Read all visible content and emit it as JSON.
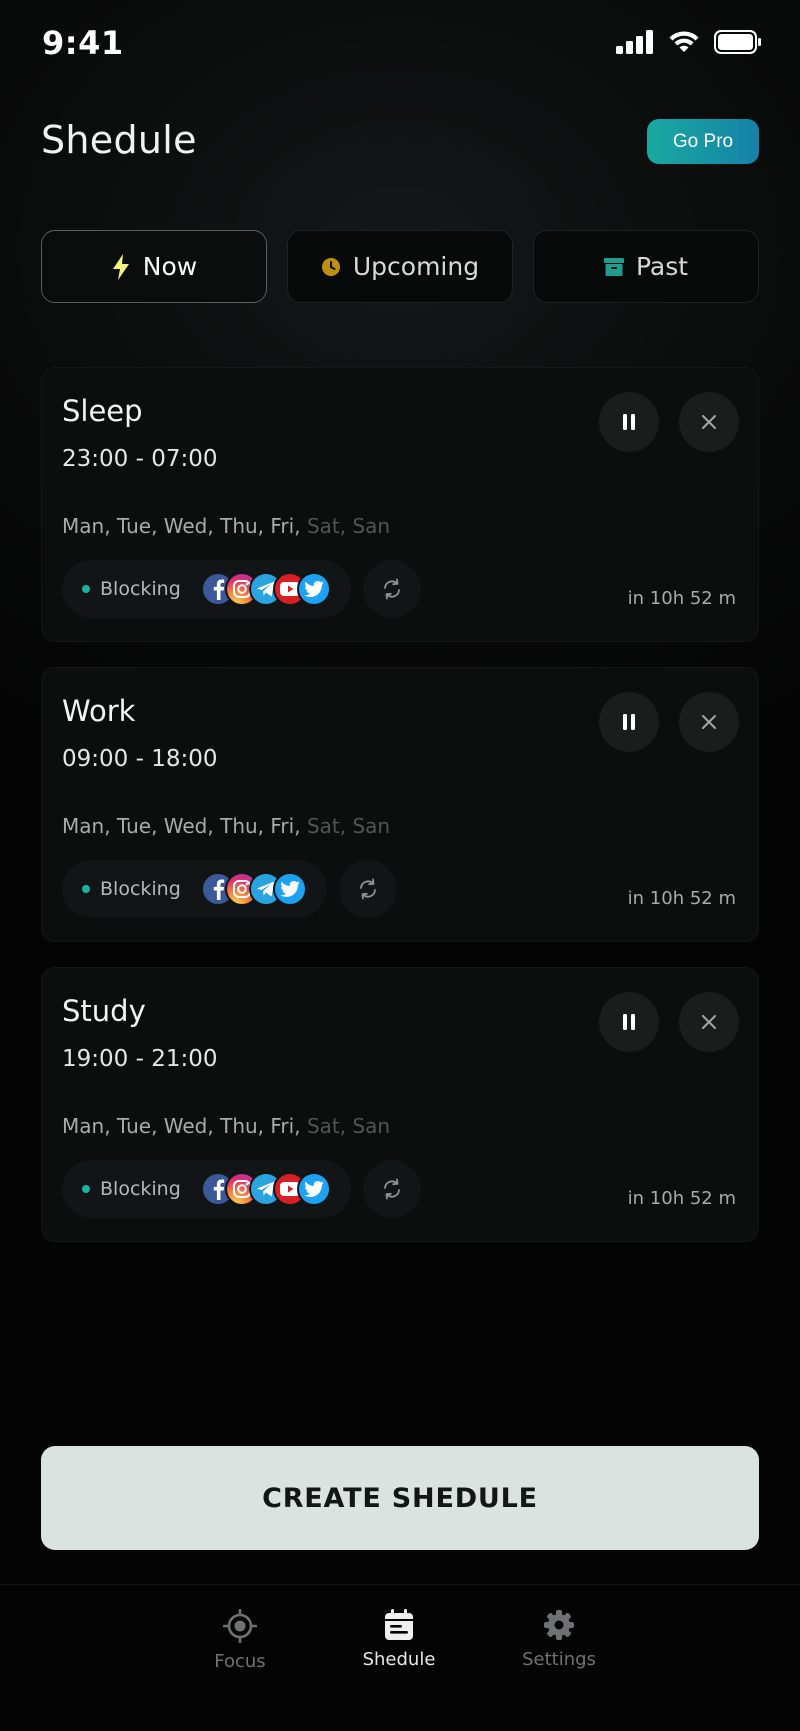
{
  "status_bar": {
    "time": "9:41"
  },
  "header": {
    "title": "Shedule",
    "go_pro_label": "Go Pro"
  },
  "tabs": [
    {
      "label": "Now",
      "icon": "lightning-icon",
      "active": true
    },
    {
      "label": "Upcoming",
      "icon": "clock-icon",
      "active": false
    },
    {
      "label": "Past",
      "icon": "archive-icon",
      "active": false
    }
  ],
  "schedules": [
    {
      "title": "Sleep",
      "time": "23:00 - 07:00",
      "days_active": "Man, Tue, Wed, Thu, Fri,",
      "days_inactive": "Sat, San",
      "blocking_label": "Blocking",
      "apps": [
        "facebook-icon",
        "instagram-icon",
        "telegram-icon",
        "youtube-icon",
        "twitter-icon"
      ],
      "eta": "in 10h 52 m"
    },
    {
      "title": "Work",
      "time": "09:00 - 18:00",
      "days_active": "Man, Tue, Wed, Thu, Fri,",
      "days_inactive": "Sat, San",
      "blocking_label": "Blocking",
      "apps": [
        "facebook-icon",
        "instagram-icon",
        "telegram-icon",
        "twitter-icon"
      ],
      "eta": "in 10h 52 m"
    },
    {
      "title": "Study",
      "time": "19:00 - 21:00",
      "days_active": "Man, Tue, Wed, Thu, Fri,",
      "days_inactive": "Sat, San",
      "blocking_label": "Blocking",
      "apps": [
        "facebook-icon",
        "instagram-icon",
        "telegram-icon",
        "youtube-icon",
        "twitter-icon"
      ],
      "eta": "in 10h 52 m"
    }
  ],
  "create_button_label": "CREATE SHEDULE",
  "bottom_nav": [
    {
      "label": "Focus",
      "icon": "target-icon",
      "active": false
    },
    {
      "label": "Shedule",
      "icon": "calendar-icon",
      "active": true
    },
    {
      "label": "Settings",
      "icon": "gear-icon",
      "active": false
    }
  ],
  "colors": {
    "accent": "#19a9a0",
    "background": "#040404",
    "card": "#0c0d0d",
    "create_button": "#dbe3e1"
  }
}
